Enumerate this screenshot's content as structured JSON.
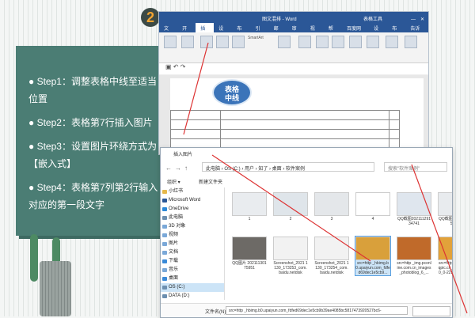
{
  "step_badge": "2",
  "steps": [
    "● Step1：调整表格中线至适当位置",
    "● Step2：表格第7行插入图片",
    "● Step3：设置图片环绕方式为【嵌入式】",
    "● Step4：表格第7列第2行输入对应的第一段文字"
  ],
  "word": {
    "title": "图文混排 - Word",
    "context_title": "表格工具",
    "tabs": [
      "文件",
      "开始",
      "插入",
      "设计",
      "布局",
      "引用",
      "邮件",
      "审阅",
      "视图",
      "帮助",
      "百度网盘",
      "设计",
      "布局",
      "告诉我"
    ],
    "active_tab": "插入",
    "smartart_label": "SmartArt",
    "callout": "表格\n中线"
  },
  "dialog": {
    "title": "插入图片",
    "breadcrumb": "此电脑 › OS (C:) › 用户 › 知了 › 桌面 › 软件案例",
    "search_placeholder": "搜索\"软件案例\"",
    "organize": "组织 ▾",
    "new_folder": "新建文件夹",
    "nav_items": [
      {
        "label": "小红书",
        "color": "#e6b84a"
      },
      {
        "label": "Microsoft Word",
        "color": "#2b5797"
      },
      {
        "label": "OneDrive",
        "color": "#2b88d8"
      },
      {
        "label": "此电脑",
        "color": "#6c8fb0"
      },
      {
        "label": "3D 对象",
        "color": "#7aa8d8"
      },
      {
        "label": "视频",
        "color": "#7aa8d8"
      },
      {
        "label": "图片",
        "color": "#7aa8d8"
      },
      {
        "label": "文档",
        "color": "#7aa8d8"
      },
      {
        "label": "下载",
        "color": "#3a8ad8"
      },
      {
        "label": "音乐",
        "color": "#7aa8d8"
      },
      {
        "label": "桌面",
        "color": "#3a8ad8"
      },
      {
        "label": "OS (C:)",
        "color": "#6c8fb0"
      },
      {
        "label": "DATA (D:)",
        "color": "#6c8fb0"
      }
    ],
    "selected_nav": "OS (C:)",
    "thumbs": [
      {
        "caption": "1",
        "color": "#e9ecef"
      },
      {
        "caption": "2",
        "color": "#dfe5ea"
      },
      {
        "caption": "3",
        "color": "#e4e7ea"
      },
      {
        "caption": "4",
        "color": "#ffffff"
      },
      {
        "caption": "QQ截图20211129134741",
        "color": "#dfe6ee"
      },
      {
        "caption": "QQ截图202111291523 0",
        "color": "#e8ebee"
      },
      {
        "caption": "QQ截图2021113010303 3",
        "color": "#b3b7bb"
      },
      {
        "caption": "QQ图片 20211130175951",
        "color": "#6d6a66"
      },
      {
        "caption": "Screenshot_2021 1130_173253_com.baidu.netdisk",
        "color": "#f2f2f2"
      },
      {
        "caption": "Screenshot_2021 1130_173254_com.baidu.netdisk",
        "color": "#f2f2f2"
      },
      {
        "caption": "src=http _hbimg.b0.upaiyun.com_fdfed69dec1e5cb9...",
        "color": "#d9a03b"
      },
      {
        "caption": "src=http _img.pconline.com.cn_images_photoblog_6_...",
        "color": "#c06a2a"
      },
      {
        "caption": "src=http _qqpublic.qpic.cn_qq_public_0_0-2234240514...",
        "color": "#e2a23a"
      }
    ],
    "filename_label": "文件名(N):",
    "filename_value": "src=http _hbimg.b0.upaiyun.com_fdfed69dec1e5cb9b39ae4085bc5817473920527bc6-"
  }
}
